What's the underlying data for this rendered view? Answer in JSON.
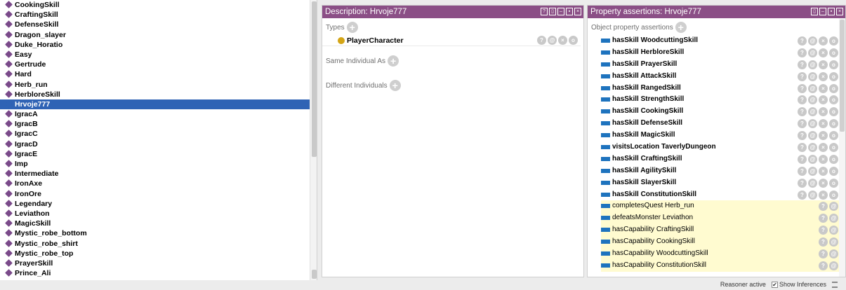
{
  "individuals": [
    {
      "label": "CookingSkill"
    },
    {
      "label": "CraftingSkill"
    },
    {
      "label": "DefenseSkill"
    },
    {
      "label": "Dragon_slayer"
    },
    {
      "label": "Duke_Horatio"
    },
    {
      "label": "Easy"
    },
    {
      "label": "Gertrude"
    },
    {
      "label": "Hard"
    },
    {
      "label": "Herb_run"
    },
    {
      "label": "HerbloreSkill"
    },
    {
      "label": "Hrvoje777",
      "selected": true
    },
    {
      "label": "IgracA"
    },
    {
      "label": "IgracB"
    },
    {
      "label": "IgracC"
    },
    {
      "label": "IgracD"
    },
    {
      "label": "IgracE"
    },
    {
      "label": "Imp"
    },
    {
      "label": "Intermediate"
    },
    {
      "label": "IronAxe"
    },
    {
      "label": "IronOre"
    },
    {
      "label": "Legendary"
    },
    {
      "label": "Leviathon"
    },
    {
      "label": "MagicSkill"
    },
    {
      "label": "Mystic_robe_bottom"
    },
    {
      "label": "Mystic_robe_shirt"
    },
    {
      "label": "Mystic_robe_top"
    },
    {
      "label": "PrayerSkill"
    },
    {
      "label": "Prince_Ali"
    }
  ],
  "description": {
    "title": "Description: Hrvoje777",
    "types_label": "Types",
    "types": [
      "PlayerCharacter"
    ],
    "same_individual_label": "Same Individual As",
    "different_individuals_label": "Different Individuals"
  },
  "property_assertions": {
    "title": "Property assertions: Hrvoje777",
    "object_label": "Object property assertions",
    "items": [
      {
        "text": "hasSkill  WoodcuttingSkill",
        "inferred": false
      },
      {
        "text": "hasSkill  HerbloreSkill",
        "inferred": false
      },
      {
        "text": "hasSkill  PrayerSkill",
        "inferred": false
      },
      {
        "text": "hasSkill  AttackSkill",
        "inferred": false
      },
      {
        "text": "hasSkill  RangedSkill",
        "inferred": false
      },
      {
        "text": "hasSkill  StrengthSkill",
        "inferred": false
      },
      {
        "text": "hasSkill  CookingSkill",
        "inferred": false
      },
      {
        "text": "hasSkill  DefenseSkill",
        "inferred": false
      },
      {
        "text": "hasSkill  MagicSkill",
        "inferred": false
      },
      {
        "text": "visitsLocation  TaverlyDungeon",
        "inferred": false
      },
      {
        "text": "hasSkill  CraftingSkill",
        "inferred": false
      },
      {
        "text": "hasSkill  AgilitySkill",
        "inferred": false
      },
      {
        "text": "hasSkill  SlayerSkill",
        "inferred": false
      },
      {
        "text": "hasSkill  ConstitutionSkill",
        "inferred": false
      },
      {
        "text": "completesQuest  Herb_run",
        "inferred": true
      },
      {
        "text": "defeatsMonster  Leviathon",
        "inferred": true
      },
      {
        "text": "hasCapability  CraftingSkill",
        "inferred": true
      },
      {
        "text": "hasCapability  CookingSkill",
        "inferred": true
      },
      {
        "text": "hasCapability  WoodcuttingSkill",
        "inferred": true
      },
      {
        "text": "hasCapability  ConstitutionSkill",
        "inferred": true
      }
    ]
  },
  "status": {
    "reasoner": "Reasoner active",
    "show_inferences": "Show Inferences",
    "show_inferences_checked": true
  },
  "colors": {
    "header_bg": "#8b4f86",
    "selected_bg": "#2f63b5",
    "individual_icon": "#7a4a8a",
    "class_icon": "#d4a516",
    "property_icon": "#1e73be",
    "inferred_bg": "#fffbd0"
  }
}
